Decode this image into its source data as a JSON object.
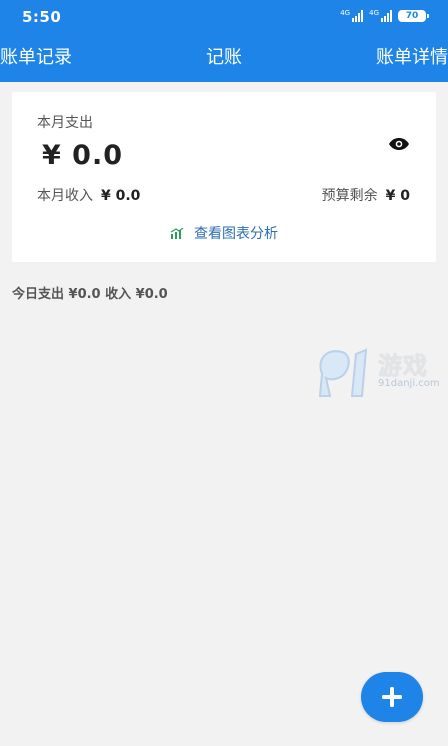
{
  "status_bar": {
    "time": "5:50",
    "signal_tag_1": "4G",
    "signal_tag_2": "4G",
    "battery": "70"
  },
  "nav": {
    "left": "账单记录",
    "title": "记账",
    "right": "账单详情"
  },
  "summary": {
    "month_expense_label": "本月支出",
    "month_expense_value": "¥ 0.0",
    "month_income_label": "本月收入",
    "month_income_value": "¥ 0.0",
    "budget_remaining_label": "预算剩余",
    "budget_remaining_value": "¥ 0",
    "chart_link": "查看图表分析"
  },
  "today_line": "今日支出 ¥0.0 收入 ¥0.0",
  "watermark": {
    "brand": "游戏",
    "domain": "91danji.com"
  },
  "fab_icon": "plus-icon",
  "colors": {
    "primary": "#1e84e8",
    "background": "#f2f2f2"
  }
}
